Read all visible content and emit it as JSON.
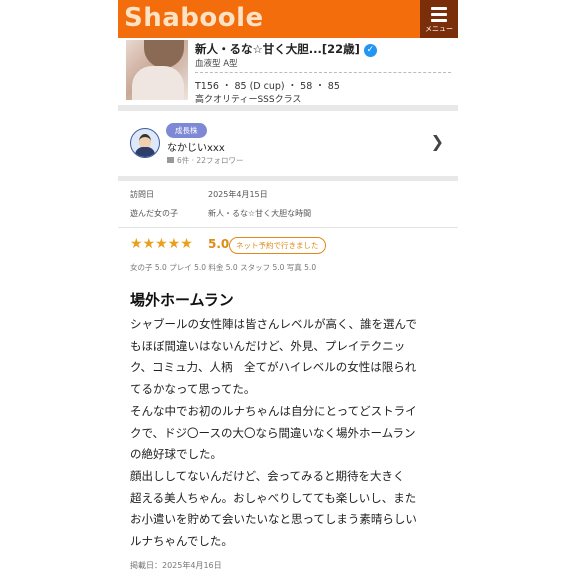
{
  "header": {
    "logo": "Shaboole",
    "menu_label": "メニュー"
  },
  "profile": {
    "name": "新人・るな☆甘く大胆...[22歳]",
    "verified_icon": "verified-check-icon",
    "blood_type": "血液型 A型",
    "size": "T156 ・ 85 (D cup) ・ 58 ・ 85",
    "class": "高クオリティーSSSクラス"
  },
  "user": {
    "badge": "成長株",
    "name": "なかじいxxx",
    "stats": "6件 · 22フォロワー"
  },
  "info": {
    "visit_label": "訪問日",
    "visit_value": "2025年4月15日",
    "girl_label": "遊んだ女の子",
    "girl_value": "新人・るな☆甘く大胆な時間"
  },
  "rating": {
    "stars": "★★★★★",
    "score": "5.0",
    "reserve_tag": "ネット予約で行きました",
    "subscores": "女の子 5.0  プレイ 5.0  料金 5.0  スタッフ 5.0  写真 5.0"
  },
  "review": {
    "title": "場外ホームラン",
    "lines": [
      "シャブールの女性陣は皆さんレベルが高く、誰を選んで",
      "もほぼ間違いはないんだけど、外見、プレイテクニッ",
      "ク、コミュ力、人柄　全てがハイレベルの女性は限られ",
      "てるかなって思ってた。",
      "そんな中でお初のルナちゃんは自分にとってどストライ",
      "クで、ドジ〇ースの大〇なら間違いなく場外ホームラン",
      "の絶好球でした。",
      "顔出ししてないんだけど、会ってみると期待を大きく",
      "超える美人ちゃん。おしゃべりしてても楽しいし、また",
      "お小遣いを貯めて会いたいなと思ってしまう素晴らしい",
      "ルナちゃんでした。"
    ],
    "posted": "掲載日：2025年4月16日"
  }
}
